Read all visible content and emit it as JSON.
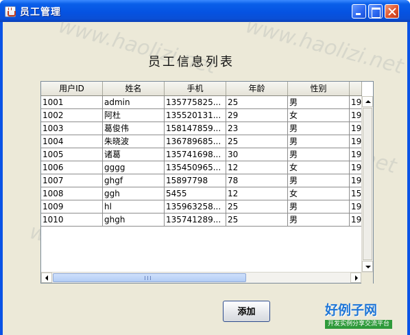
{
  "window": {
    "title": "员工管理"
  },
  "main": {
    "list_title": "员工信息列表",
    "add_button": "添加"
  },
  "table": {
    "columns": [
      "用户ID",
      "姓名",
      "手机",
      "年龄",
      "性别",
      ""
    ],
    "rows": [
      [
        "1001",
        "admin",
        "135775825...",
        "25",
        "男",
        "19"
      ],
      [
        "1002",
        "阿杜",
        "135520131...",
        "29",
        "女",
        "19"
      ],
      [
        "1003",
        "葛俊伟",
        "158147859...",
        "23",
        "男",
        "19"
      ],
      [
        "1004",
        "朱晓波",
        "136789685...",
        "25",
        "男",
        "19"
      ],
      [
        "1005",
        "诸葛",
        "135741698...",
        "30",
        "男",
        "19"
      ],
      [
        "1006",
        "gggg",
        "135450965...",
        "12",
        "女",
        "19"
      ],
      [
        "1007",
        "ghgf",
        "15897798",
        "78",
        "男",
        "19"
      ],
      [
        "1008",
        "ggh",
        "5455",
        "12",
        "女",
        "15"
      ],
      [
        "1009",
        "hl",
        "135963258...",
        "25",
        "男",
        "19"
      ],
      [
        "1010",
        "ghgh",
        "135741289...",
        "25",
        "男",
        "19"
      ]
    ]
  },
  "watermark": {
    "text": "www.haolizi.net"
  },
  "logo": {
    "name": "好例子网",
    "tagline": "开发实例分享交流平台"
  },
  "colors": {
    "titlebar": "#0553e2",
    "window_bg": "#ece9d8",
    "close_button": "#e0542d",
    "logo_blue": "#1f76d6",
    "logo_green": "#2e9a3a"
  }
}
